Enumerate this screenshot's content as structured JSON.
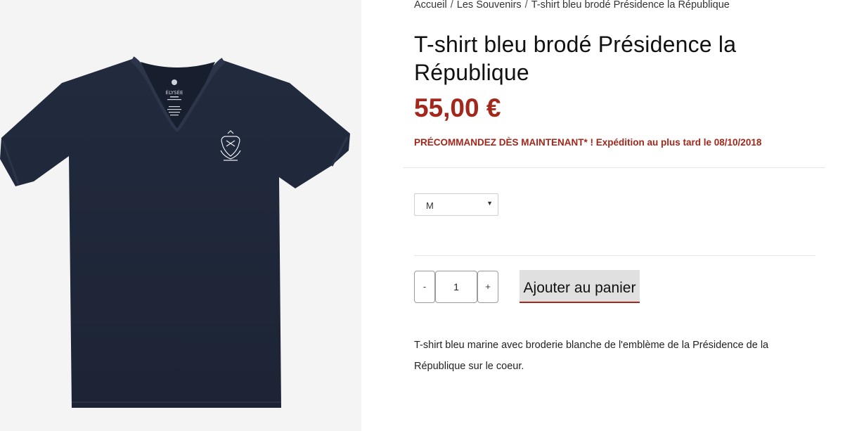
{
  "breadcrumb": {
    "items": [
      "Accueil",
      "Les Souvenirs",
      "T-shirt bleu brodé Présidence la République"
    ],
    "separator": "/"
  },
  "product": {
    "title": "T-shirt bleu brodé Présidence la République",
    "price": "55,00 €",
    "preorder_notice": "PRÉCOMMANDEZ DÈS MAINTENANT* ! Expédition au plus tard le 08/10/2018",
    "size": {
      "selected": "M",
      "arrow": "▼"
    },
    "quantity": {
      "minus": "-",
      "value": "1",
      "plus": "+"
    },
    "add_to_cart": "Ajouter au panier",
    "description": "T-shirt bleu marine avec broderie blanche de l'emblème de la Présidence de la République sur le coeur.",
    "label_brand": "ÉLYSÉE"
  },
  "colors": {
    "accent": "#a3271b",
    "shirt": "#1f2739",
    "image_background": "#f4f4f4"
  }
}
